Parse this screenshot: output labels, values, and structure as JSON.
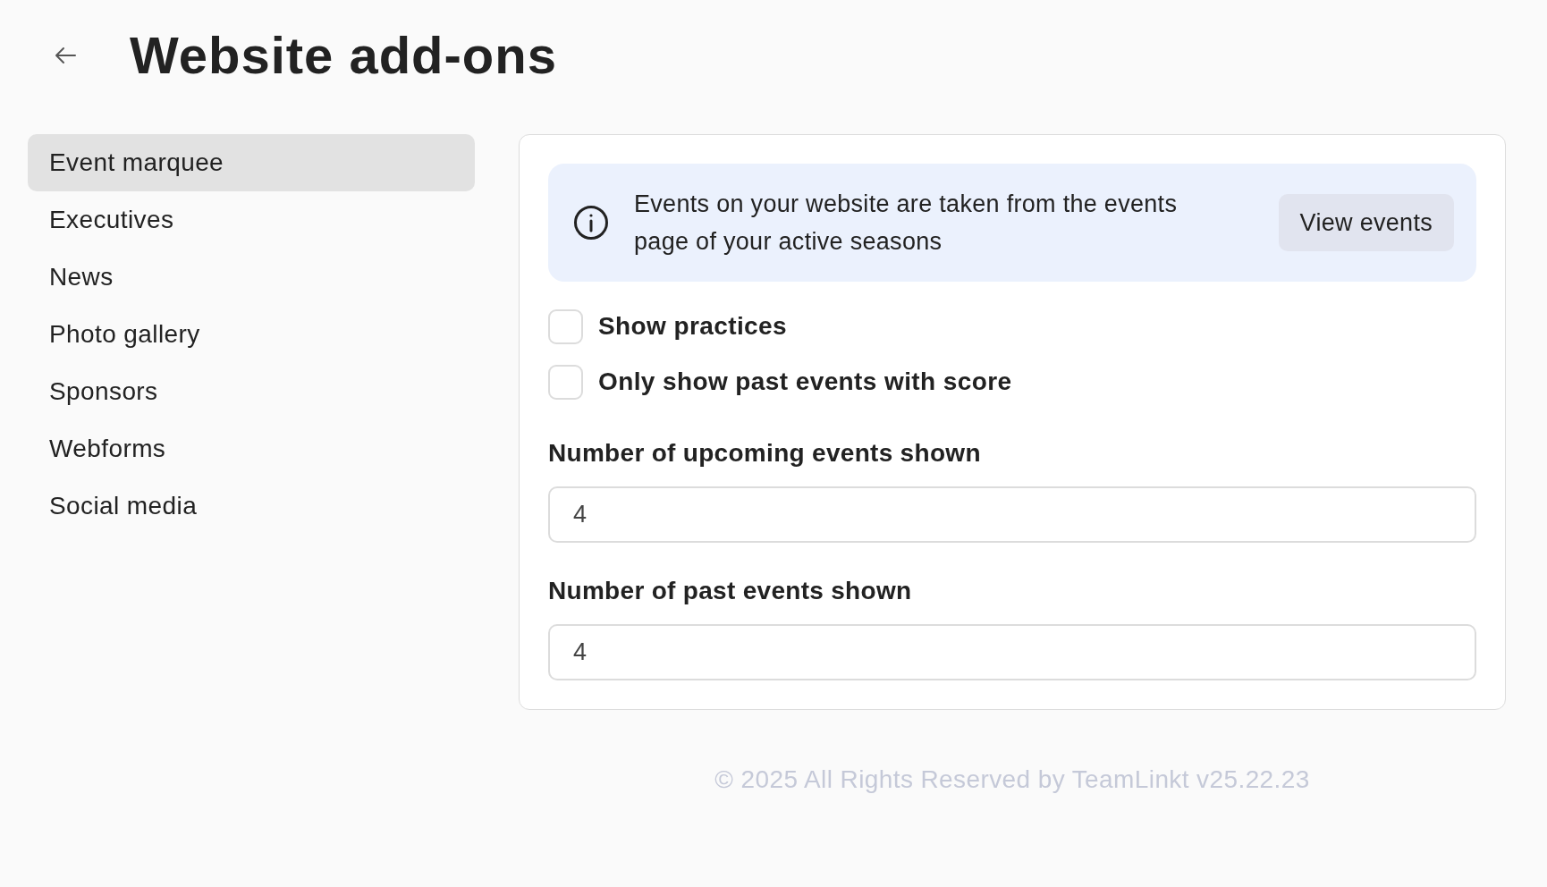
{
  "header": {
    "title": "Website add-ons"
  },
  "sidebar": {
    "items": [
      {
        "label": "Event marquee",
        "selected": true
      },
      {
        "label": "Executives",
        "selected": false
      },
      {
        "label": "News",
        "selected": false
      },
      {
        "label": "Photo gallery",
        "selected": false
      },
      {
        "label": "Sponsors",
        "selected": false
      },
      {
        "label": "Webforms",
        "selected": false
      },
      {
        "label": "Social media",
        "selected": false
      }
    ]
  },
  "banner": {
    "text": "Events on your website are taken from the events page of your active seasons",
    "button": "View events"
  },
  "checkboxes": [
    {
      "label": "Show practices",
      "checked": false
    },
    {
      "label": "Only show past events with score",
      "checked": false
    }
  ],
  "fields": [
    {
      "label": "Number of upcoming events shown",
      "value": "4"
    },
    {
      "label": "Number of past events shown",
      "value": "4"
    }
  ],
  "footer": "© 2025 All Rights Reserved by TeamLinkt v25.22.23"
}
